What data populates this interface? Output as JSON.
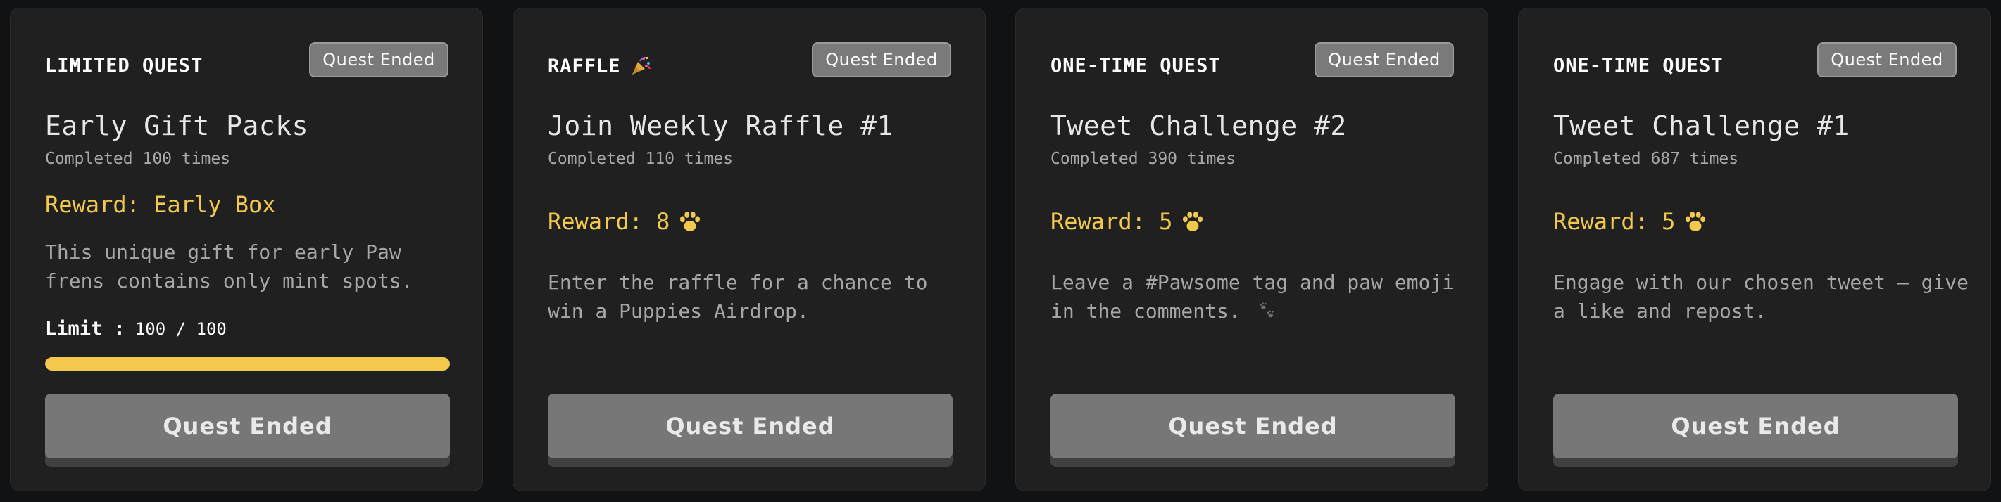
{
  "colors": {
    "background": "#111213",
    "card": "#202020",
    "accent": "#f2c94c",
    "badge": "#7a7a7a",
    "button": "#777777"
  },
  "cards": [
    {
      "type": "LIMITED QUEST",
      "status": "Quest Ended",
      "title": "Early Gift Packs",
      "completed": "Completed 100 times",
      "reward": "Reward: Early Box",
      "description": "This unique gift for early Paw frens contains only mint spots.",
      "limit_label": "Limit :",
      "limit_value": "100 / 100",
      "limit_progress": 1.0,
      "button": "Quest Ended"
    },
    {
      "type": "RAFFLE",
      "type_icon": "party-popper-icon",
      "status": "Quest Ended",
      "title": "Join Weekly Raffle #1",
      "completed": "Completed 110 times",
      "reward": "Reward: 8",
      "reward_icon": "paw-icon",
      "description": "Enter the raffle for a chance to win a Puppies Airdrop.",
      "button": "Quest Ended"
    },
    {
      "type": "ONE-TIME QUEST",
      "status": "Quest Ended",
      "title": "Tweet Challenge #2",
      "completed": "Completed 390 times",
      "reward": "Reward: 5",
      "reward_icon": "paw-icon",
      "description": "Leave a #Pawsome tag and paw emoji in the comments.",
      "description_icon": "paw-prints-icon",
      "button": "Quest Ended"
    },
    {
      "type": "ONE-TIME QUEST",
      "status": "Quest Ended",
      "title": "Tweet Challenge #1",
      "completed": "Completed 687 times",
      "reward": "Reward: 5",
      "reward_icon": "paw-icon",
      "description": "Engage with our chosen tweet – give a like and repost.",
      "button": "Quest Ended"
    }
  ]
}
